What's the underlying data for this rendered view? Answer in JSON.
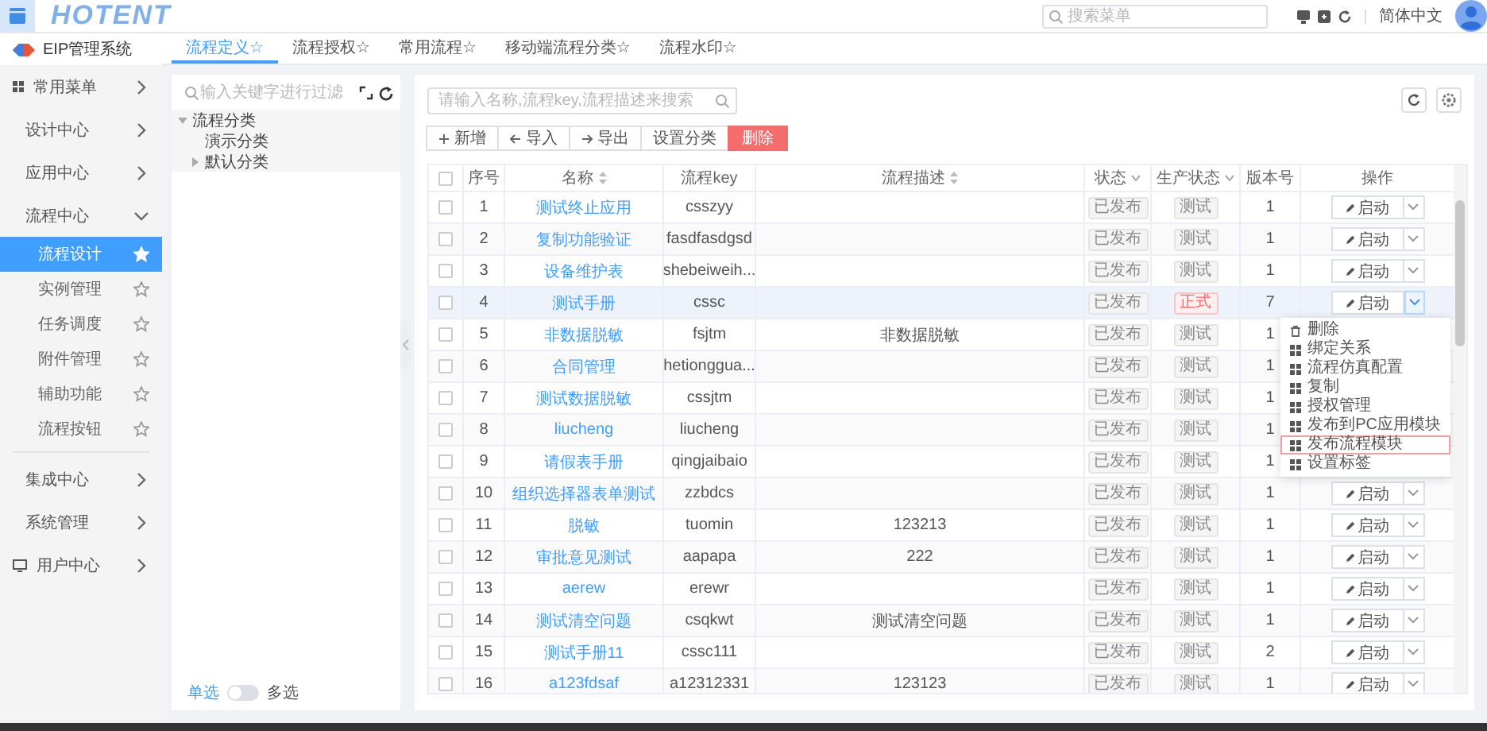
{
  "header": {
    "logo": "HOTENT",
    "search": {
      "placeholder": "搜索菜单"
    },
    "language": "简体中文"
  },
  "sidebar": {
    "system": "EIP管理系统",
    "items": [
      {
        "label": "常用菜单",
        "expanded": false
      },
      {
        "label": "设计中心",
        "expanded": false
      },
      {
        "label": "应用中心",
        "expanded": false
      },
      {
        "label": "流程中心",
        "expanded": true,
        "children": [
          {
            "label": "流程设计",
            "selected": true,
            "starred": true
          },
          {
            "label": "实例管理",
            "selected": false,
            "starred": false
          },
          {
            "label": "任务调度",
            "selected": false,
            "starred": false
          },
          {
            "label": "附件管理",
            "selected": false,
            "starred": false
          },
          {
            "label": "辅助功能",
            "selected": false,
            "starred": false
          },
          {
            "label": "流程按钮",
            "selected": false,
            "starred": false
          }
        ]
      },
      {
        "label": "集成中心",
        "expanded": false
      },
      {
        "label": "系统管理",
        "expanded": false
      },
      {
        "label": "用户中心",
        "expanded": false
      }
    ]
  },
  "tabs": [
    {
      "label": "流程定义☆",
      "selected": true
    },
    {
      "label": "流程授权☆",
      "selected": false
    },
    {
      "label": "常用流程☆",
      "selected": false
    },
    {
      "label": "移动端流程分类☆",
      "selected": false
    },
    {
      "label": "流程水印☆",
      "selected": false
    }
  ],
  "tree": {
    "filter": {
      "placeholder": "输入关键字进行过滤"
    },
    "nodes": [
      {
        "label": "流程分类",
        "expanded": true,
        "children": [
          {
            "label": "演示分类"
          },
          {
            "label": "默认分类",
            "expanded": false
          }
        ]
      }
    ],
    "mode": {
      "single": "单选",
      "multiple": "多选",
      "on": false
    }
  },
  "search": {
    "placeholder": "请输入名称,流程key,流程描述来搜索"
  },
  "toolbar": [
    {
      "label": "新增",
      "kind": "normal"
    },
    {
      "label": "导入",
      "kind": "normal"
    },
    {
      "label": "导出",
      "kind": "normal"
    },
    {
      "label": "设置分类",
      "kind": "normal"
    },
    {
      "label": "删除",
      "kind": "danger"
    }
  ],
  "table": {
    "header_checked": false,
    "columns": [
      {
        "label": "序号"
      },
      {
        "label": "名称"
      },
      {
        "label": "流程key"
      },
      {
        "label": "流程描述"
      },
      {
        "label": "状态"
      },
      {
        "label": "生产状态"
      },
      {
        "label": "版本号"
      },
      {
        "label": "操作"
      }
    ],
    "rows": [
      {
        "no": "1",
        "name": "测试终止应用",
        "key": "csszyy",
        "status": "已发布",
        "prod": "测试",
        "formal": false,
        "version": "1",
        "action": "启动",
        "checked": false
      },
      {
        "no": "2",
        "name": "复制功能验证",
        "key": "fasdfasdgsd",
        "status": "已发布",
        "prod": "测试",
        "formal": false,
        "version": "1",
        "action": "启动",
        "checked": false
      },
      {
        "no": "3",
        "name": "设备维护表",
        "key": "shebeiweih...",
        "status": "已发布",
        "prod": "测试",
        "formal": false,
        "version": "1",
        "action": "启动",
        "checked": false
      },
      {
        "no": "4",
        "name": "测试手册",
        "key": "cssc",
        "status": "已发布",
        "prod": "正式",
        "formal": true,
        "version": "7",
        "action": "启动",
        "checked": false,
        "menu": [
          {
            "label": "删除",
            "focused": false
          },
          {
            "label": "绑定关系",
            "focused": false
          },
          {
            "label": "流程仿真配置",
            "focused": false
          },
          {
            "label": "复制",
            "focused": false
          },
          {
            "label": "授权管理",
            "focused": false
          },
          {
            "label": "发布到PC应用模块",
            "focused": false
          },
          {
            "label": "发布流程模块",
            "focused": true
          },
          {
            "label": "设置标签",
            "focused": false
          }
        ]
      },
      {
        "no": "5",
        "name": "非数据脱敏",
        "key": "fsjtm",
        "desc": "非数据脱敏",
        "status": "已发布",
        "prod": "测试",
        "formal": false,
        "version": "1",
        "checked": false
      },
      {
        "no": "6",
        "name": "合同管理",
        "key": "hetionggua...",
        "status": "已发布",
        "prod": "测试",
        "formal": false,
        "version": "1",
        "checked": false
      },
      {
        "no": "7",
        "name": "测试数据脱敏",
        "key": "cssjtm",
        "status": "已发布",
        "prod": "测试",
        "formal": false,
        "version": "1",
        "checked": false
      },
      {
        "no": "8",
        "name": "liucheng",
        "key": "liucheng",
        "status": "已发布",
        "prod": "测试",
        "formal": false,
        "version": "1",
        "checked": false
      },
      {
        "no": "9",
        "name": "请假表手册",
        "key": "qingjaibaio",
        "status": "已发布",
        "prod": "测试",
        "formal": false,
        "version": "1",
        "checked": false
      },
      {
        "no": "10",
        "name": "组织选择器表单测试",
        "key": "zzbdcs",
        "status": "已发布",
        "prod": "测试",
        "formal": false,
        "version": "1",
        "action": "启动",
        "checked": false
      },
      {
        "no": "11",
        "name": "脱敏",
        "key": "tuomin",
        "desc": "123213",
        "status": "已发布",
        "prod": "测试",
        "formal": false,
        "version": "1",
        "action": "启动",
        "checked": false
      },
      {
        "no": "12",
        "name": "审批意见测试",
        "key": "aapapa",
        "desc": "222",
        "status": "已发布",
        "prod": "测试",
        "formal": false,
        "version": "1",
        "action": "启动",
        "checked": false
      },
      {
        "no": "13",
        "name": "aerew",
        "key": "erewr",
        "status": "已发布",
        "prod": "测试",
        "formal": false,
        "version": "1",
        "action": "启动",
        "checked": false
      },
      {
        "no": "14",
        "name": "测试清空问题",
        "key": "csqkwt",
        "desc": "测试清空问题",
        "status": "已发布",
        "prod": "测试",
        "formal": false,
        "version": "1",
        "action": "启动",
        "checked": false
      },
      {
        "no": "15",
        "name": "测试手册11",
        "key": "cssc111",
        "status": "已发布",
        "prod": "测试",
        "formal": false,
        "version": "2",
        "action": "启动",
        "checked": false
      },
      {
        "no": "16",
        "name": "a123fdsaf",
        "key": "a12312331",
        "desc": "123123",
        "status": "已发布",
        "prod": "测试",
        "formal": false,
        "version": "1",
        "action": "启动",
        "checked": false
      }
    ]
  }
}
